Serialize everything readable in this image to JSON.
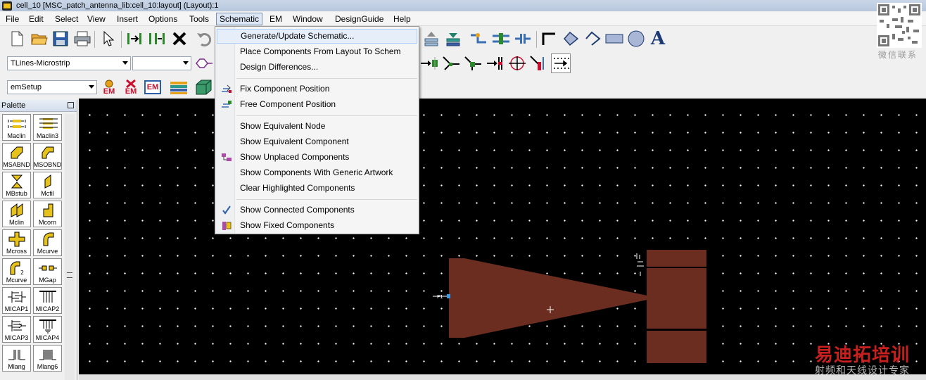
{
  "window": {
    "title": "cell_10 [MSC_patch_antenna_lib:cell_10:layout] (Layout):1"
  },
  "menubar": [
    "File",
    "Edit",
    "Select",
    "View",
    "Insert",
    "Options",
    "Tools",
    "Schematic",
    "EM",
    "Window",
    "DesignGuide",
    "Help"
  ],
  "open_menu": "Schematic",
  "toolbar": {
    "component_library": "TLines-Microstrip",
    "component_name": "",
    "em_setup": "emSetup",
    "em_label_1": "EM",
    "em_label_2": "EM",
    "em_label_3": "EM",
    "text_tool_glyph": "A"
  },
  "palette": {
    "title": "Palette",
    "items": [
      "Maclin",
      "Maclin3",
      "MSABND",
      "MSOBND",
      "MBstub",
      "Mcfil",
      "Mclin",
      "Mcorn",
      "Mcross",
      "Mcurve",
      "Mcurve",
      "MGap",
      "MICAP1",
      "MICAP2",
      "MICAP3",
      "MICAP4",
      "Mlang",
      "Mlang6"
    ]
  },
  "schematic_menu": {
    "groups": [
      [
        {
          "label": "Generate/Update Schematic...",
          "icon": "none",
          "highlighted": true
        },
        {
          "label": "Place Components From Layout To Schem",
          "icon": "none"
        },
        {
          "label": "Design Differences...",
          "icon": "none"
        }
      ],
      [
        {
          "label": "Fix Component Position",
          "icon": "fix-position-icon"
        },
        {
          "label": "Free Component Position",
          "icon": "free-position-icon"
        }
      ],
      [
        {
          "label": "Show Equivalent Node",
          "icon": "none"
        },
        {
          "label": "Show Equivalent Component",
          "icon": "none"
        },
        {
          "label": "Show Unplaced Components",
          "icon": "unplaced-components-icon"
        },
        {
          "label": "Show Components With Generic Artwork",
          "icon": "none"
        },
        {
          "label": "Clear Highlighted Components",
          "icon": "none"
        }
      ],
      [
        {
          "label": "Show Connected Components",
          "icon": "check-icon",
          "checked": true
        },
        {
          "label": "Show Fixed Components",
          "icon": "fixed-components-icon"
        }
      ]
    ]
  },
  "layout": {
    "port_label": "P1",
    "substrate_color": "#6b2d1f"
  },
  "qr_caption": "微信联系",
  "watermark": {
    "line1": "易迪拓培训",
    "line2": "射频和天线设计专家"
  },
  "colors": {
    "canvas": "#000000",
    "grid": "#ffffff",
    "metal": "#6b2d1f",
    "menu_highlight": "#e6eefa"
  }
}
